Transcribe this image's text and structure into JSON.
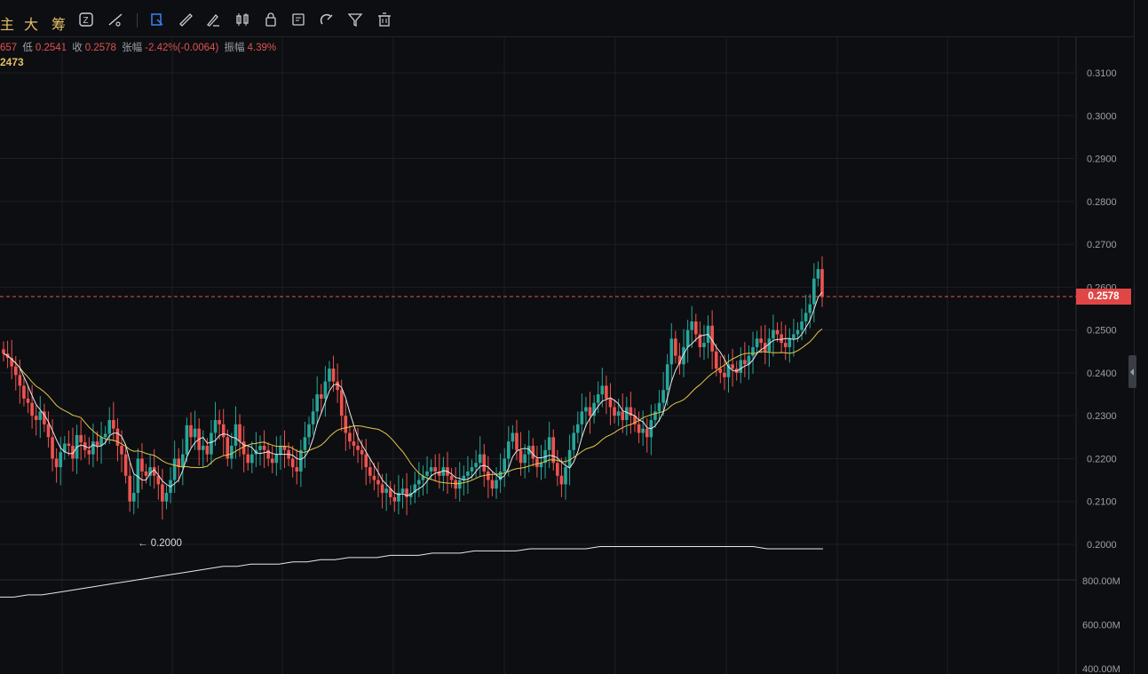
{
  "toolbar": {
    "labels": [
      "主",
      "大",
      "筹"
    ],
    "icons": [
      "z-icon",
      "line-tool-icon",
      "rect-select-icon",
      "ruler-icon",
      "brush-icon",
      "candles-icon",
      "lock-icon",
      "note-icon",
      "magnet-icon",
      "filter-icon",
      "trash-icon"
    ]
  },
  "ohlc": {
    "open_partial": "657",
    "low_label": "低",
    "low": "0.2541",
    "close_label": "收",
    "close": "0.2578",
    "change_label": "张幅",
    "change": "-2.42%(-0.0064)",
    "amp_label": "振幅",
    "amp": "4.39%"
  },
  "ma_label": "2473",
  "price_axis": [
    "0.3100",
    "0.3000",
    "0.2900",
    "0.2800",
    "0.2700",
    "0.2600",
    "0.2500",
    "0.2400",
    "0.2300",
    "0.2200",
    "0.2100",
    "0.2000"
  ],
  "volume_axis": [
    "800.00M",
    "600.00M",
    "400.00M"
  ],
  "current_price": "0.2578",
  "low_marker": "← 0.2000",
  "colors": {
    "up": "#26a69a",
    "down": "#ef5350",
    "ma_short": "#e8e8e8",
    "ma_long": "#e3c84a",
    "price_line": "#e05252"
  },
  "chart_data": {
    "type": "candlestick",
    "ylim": [
      0.195,
      0.3135
    ],
    "current": 0.2578,
    "low_marker_value": 0.2,
    "candles_close": [
      0.2445,
      0.2435,
      0.2415,
      0.2395,
      0.237,
      0.234,
      0.233,
      0.23,
      0.229,
      0.231,
      0.228,
      0.225,
      0.22,
      0.218,
      0.2215,
      0.2235,
      0.223,
      0.22,
      0.2255,
      0.2238,
      0.222,
      0.221,
      0.224,
      0.223,
      0.225,
      0.2258,
      0.229,
      0.227,
      0.223,
      0.221,
      0.216,
      0.21,
      0.212,
      0.22,
      0.217,
      0.216,
      0.218,
      0.216,
      0.214,
      0.21,
      0.212,
      0.215,
      0.22,
      0.218,
      0.221,
      0.2278,
      0.225,
      0.227,
      0.222,
      0.223,
      0.221,
      0.226,
      0.229,
      0.228,
      0.225,
      0.22,
      0.223,
      0.228,
      0.224,
      0.221,
      0.219,
      0.221,
      0.222,
      0.223,
      0.222,
      0.22,
      0.219,
      0.221,
      0.223,
      0.222,
      0.22,
      0.218,
      0.217,
      0.222,
      0.225,
      0.228,
      0.231,
      0.235,
      0.234,
      0.238,
      0.241,
      0.238,
      0.236,
      0.23,
      0.226,
      0.224,
      0.223,
      0.222,
      0.221,
      0.218,
      0.216,
      0.215,
      0.214,
      0.212,
      0.213,
      0.211,
      0.21,
      0.212,
      0.213,
      0.211,
      0.212,
      0.214,
      0.215,
      0.216,
      0.217,
      0.218,
      0.217,
      0.216,
      0.218,
      0.216,
      0.215,
      0.213,
      0.215,
      0.216,
      0.217,
      0.218,
      0.219,
      0.221,
      0.217,
      0.215,
      0.213,
      0.215,
      0.217,
      0.22,
      0.224,
      0.226,
      0.222,
      0.219,
      0.221,
      0.223,
      0.22,
      0.218,
      0.219,
      0.222,
      0.225,
      0.219,
      0.216,
      0.214,
      0.218,
      0.222,
      0.226,
      0.228,
      0.231,
      0.232,
      0.23,
      0.233,
      0.235,
      0.237,
      0.234,
      0.232,
      0.23,
      0.231,
      0.229,
      0.232,
      0.23,
      0.228,
      0.226,
      0.227,
      0.225,
      0.229,
      0.231,
      0.233,
      0.236,
      0.242,
      0.248,
      0.244,
      0.242,
      0.246,
      0.25,
      0.252,
      0.249,
      0.246,
      0.247,
      0.251,
      0.245,
      0.241,
      0.24,
      0.239,
      0.242,
      0.241,
      0.24,
      0.243,
      0.242,
      0.244,
      0.246,
      0.248,
      0.247,
      0.245,
      0.248,
      0.25,
      0.249,
      0.247,
      0.246,
      0.248,
      0.249,
      0.25,
      0.252,
      0.254,
      0.256,
      0.262,
      0.2642,
      0.2578
    ],
    "volume": [
      0.56,
      0.56,
      0.57,
      0.57,
      0.58,
      0.59,
      0.6,
      0.61,
      0.62,
      0.63,
      0.64,
      0.65,
      0.66,
      0.67,
      0.68,
      0.69,
      0.7,
      0.7,
      0.71,
      0.71,
      0.71,
      0.72,
      0.72,
      0.73,
      0.73,
      0.74,
      0.74,
      0.74,
      0.75,
      0.75,
      0.75,
      0.76,
      0.76,
      0.76,
      0.77,
      0.77,
      0.77,
      0.77,
      0.78,
      0.78,
      0.78,
      0.78,
      0.78,
      0.79,
      0.79,
      0.79,
      0.79,
      0.79,
      0.79,
      0.79,
      0.79,
      0.79,
      0.79,
      0.79,
      0.79,
      0.78,
      0.78,
      0.78,
      0.78,
      0.78
    ]
  }
}
